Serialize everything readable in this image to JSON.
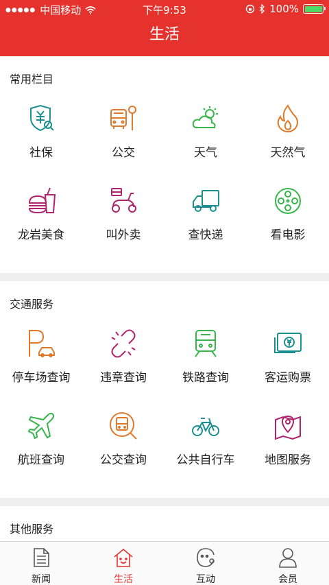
{
  "status_bar": {
    "carrier": "中国移动",
    "time": "下午9:53",
    "battery": "100%"
  },
  "header": {
    "title": "生活"
  },
  "sections": [
    {
      "title": "常用栏目",
      "items": [
        {
          "label": "社保",
          "icon": "shield-yuan-icon",
          "color": "#1a8f8f"
        },
        {
          "label": "公交",
          "icon": "bus-stop-icon",
          "color": "#e07a2a"
        },
        {
          "label": "天气",
          "icon": "weather-icon",
          "color": "#35b54a"
        },
        {
          "label": "天然气",
          "icon": "flame-icon",
          "color": "#e07a2a"
        },
        {
          "label": "龙岩美食",
          "icon": "food-icon",
          "color": "#b0246d"
        },
        {
          "label": "叫外卖",
          "icon": "scooter-icon",
          "color": "#b0246d"
        },
        {
          "label": "查快递",
          "icon": "truck-icon",
          "color": "#1a8f8f"
        },
        {
          "label": "看电影",
          "icon": "film-reel-icon",
          "color": "#35b54a"
        }
      ]
    },
    {
      "title": "交通服务",
      "items": [
        {
          "label": "停车场查询",
          "icon": "parking-icon",
          "color": "#e07a2a"
        },
        {
          "label": "违章查询",
          "icon": "broken-link-icon",
          "color": "#b0246d"
        },
        {
          "label": "铁路查询",
          "icon": "train-icon",
          "color": "#35b54a"
        },
        {
          "label": "客运购票",
          "icon": "ticket-icon",
          "color": "#1a8f8f"
        },
        {
          "label": "航班查询",
          "icon": "airplane-icon",
          "color": "#35b54a"
        },
        {
          "label": "公交查询",
          "icon": "bus-search-icon",
          "color": "#e07a2a"
        },
        {
          "label": "公共自行车",
          "icon": "bicycle-icon",
          "color": "#1a8f8f"
        },
        {
          "label": "地图服务",
          "icon": "map-icon",
          "color": "#b0246d"
        }
      ]
    },
    {
      "title": "其他服务",
      "items": []
    }
  ],
  "tabbar": {
    "items": [
      {
        "label": "新闻",
        "icon": "news-icon",
        "active": false
      },
      {
        "label": "生活",
        "icon": "home-smile-icon",
        "active": true
      },
      {
        "label": "互动",
        "icon": "interact-icon",
        "active": false
      },
      {
        "label": "会员",
        "icon": "member-icon",
        "active": false
      }
    ]
  }
}
